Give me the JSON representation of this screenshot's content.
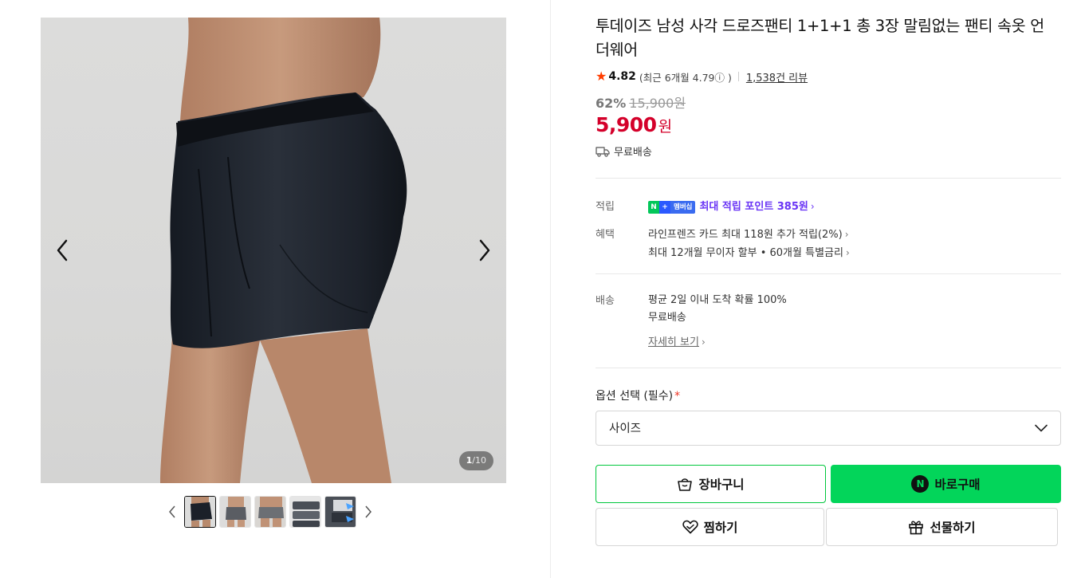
{
  "gallery": {
    "counter_current": "1",
    "counter_separator": "/",
    "counter_total": "10",
    "thumbnails": [
      "thumb-1",
      "thumb-2",
      "thumb-3",
      "thumb-4",
      "thumb-5"
    ]
  },
  "product": {
    "title": "투데이즈 남성 사각 드로즈팬티 1+1+1 총 3장 말림없는 팬티 속옷 언더웨어",
    "rating": "4.82",
    "recent_rating": "(최근 6개월 4.79ⓘ )",
    "reviews": "1,538건 리뷰",
    "discount": "62%",
    "original_price": "15,900원",
    "price": "5,900",
    "currency": "원",
    "shipping": "무료배송"
  },
  "benefits": {
    "points_label": "적립",
    "badge_n": "N",
    "badge_plus": "+",
    "badge_member": "멤버십",
    "points_text": "최대 적립 포인트 385원",
    "benefit_label": "혜택",
    "benefit_1": "라인프렌즈 카드 최대 118원 추가 적립(2%)",
    "benefit_2": "최대 12개월 무이자 할부 • 60개월 특별금리"
  },
  "delivery": {
    "label": "배송",
    "line_1": "평균 2일 이내 도착 확률 100%",
    "line_2": "무료배송",
    "detail_link": "자세히 보기"
  },
  "options": {
    "label": "옵션 선택 (필수)",
    "required_mark": "*",
    "select_value": "사이즈"
  },
  "actions": {
    "cart": "장바구니",
    "npay_mark": "N",
    "buy": "바로구매",
    "wish": "찜하기",
    "gift": "선물하기"
  },
  "colors": {
    "sale_red": "#d4002a",
    "buy_green": "#03d55a",
    "point_purple": "#6a35f5",
    "star": "#ff3d00"
  }
}
